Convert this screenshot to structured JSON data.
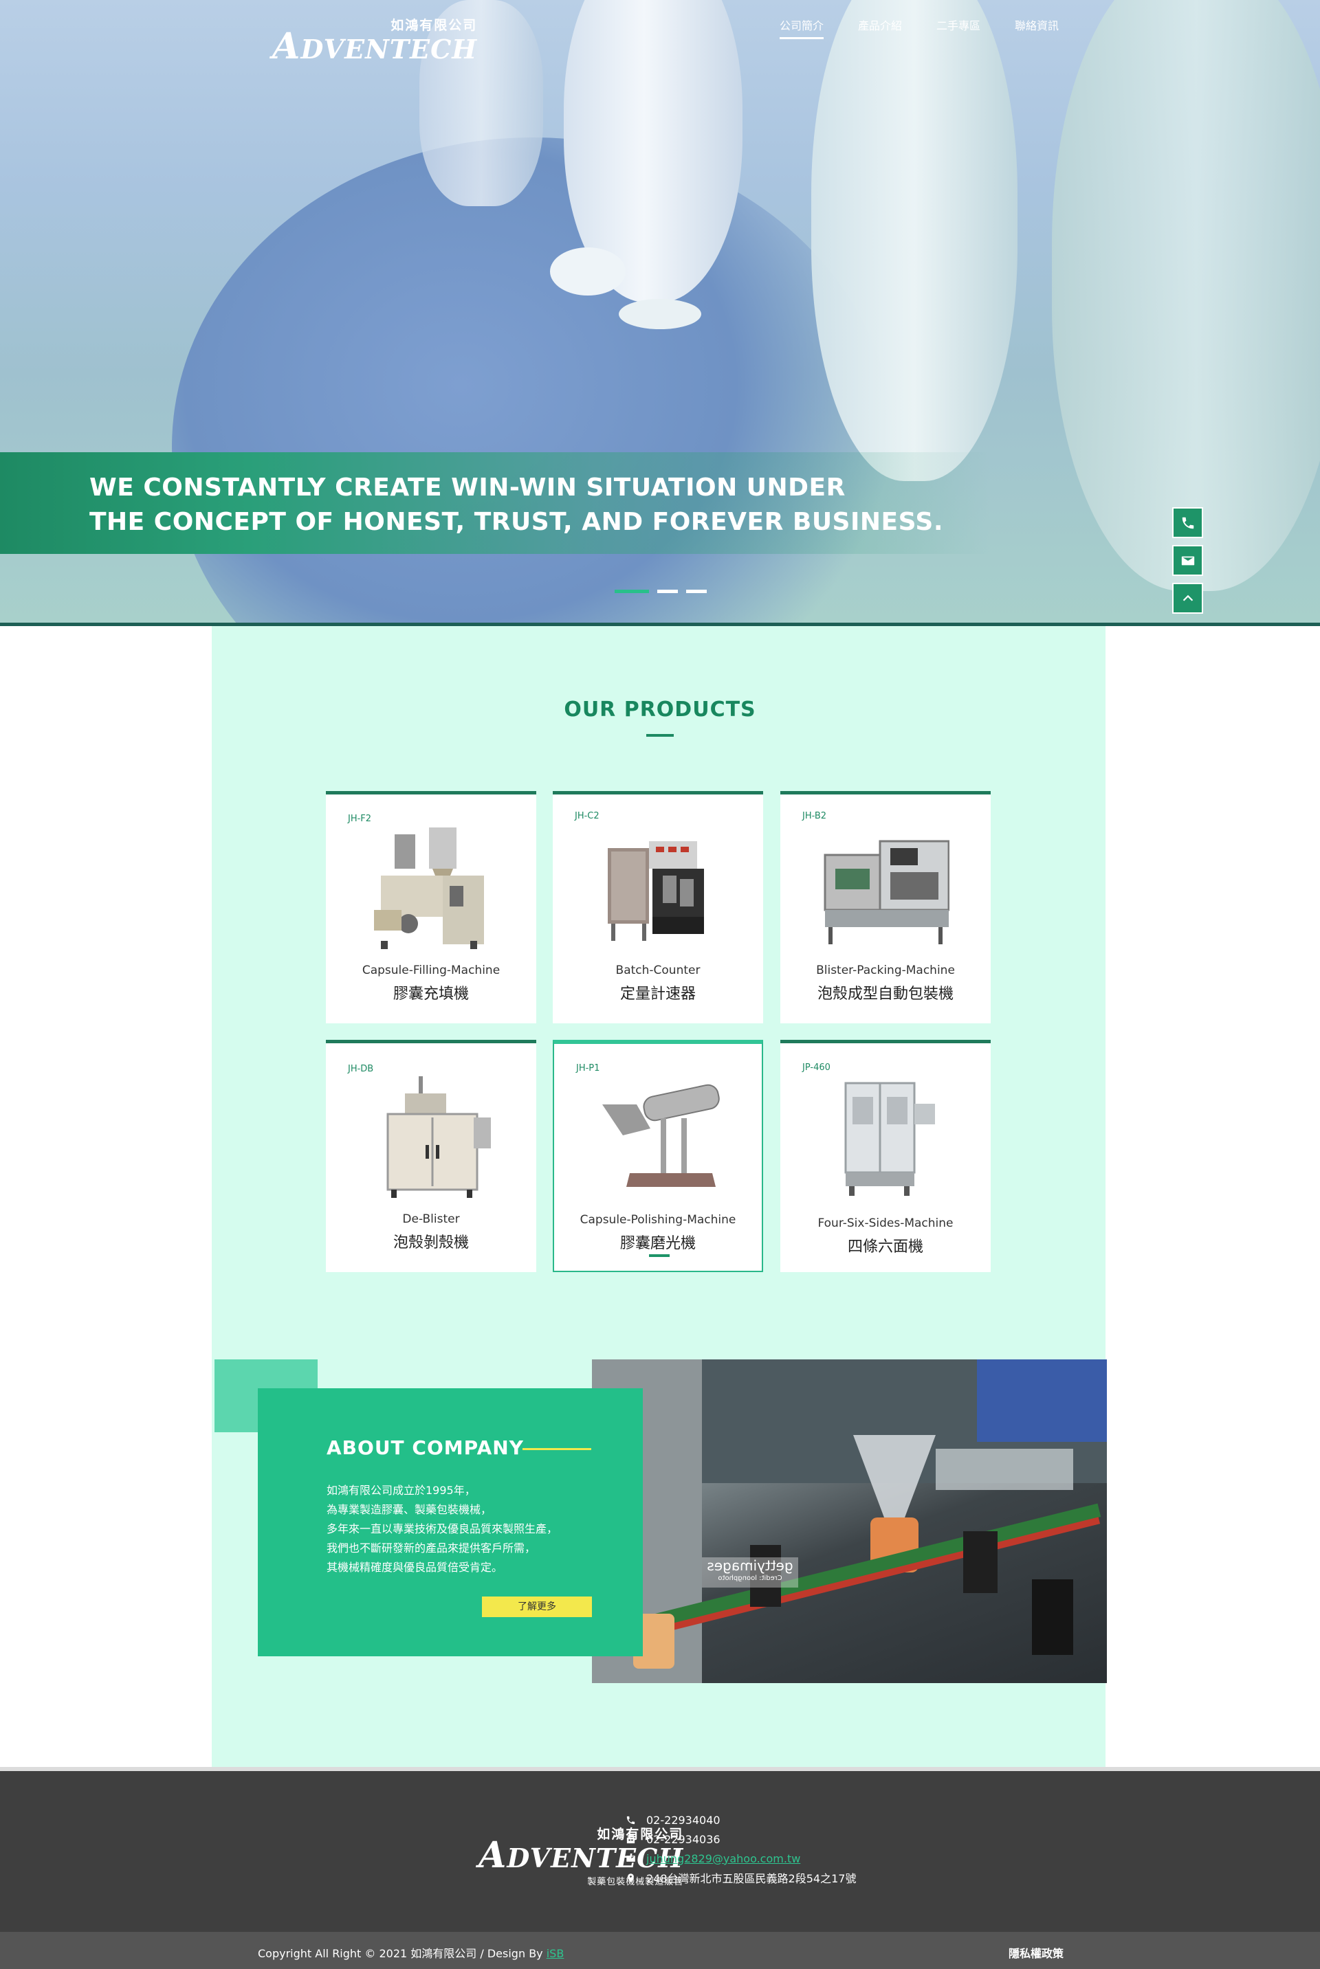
{
  "header": {
    "logo_zh": "如鴻有限公司",
    "logo_en_first": "A",
    "logo_en_rest": "DVENTECH",
    "nav": [
      {
        "label": "公司簡介",
        "active": true
      },
      {
        "label": "產品介紹"
      },
      {
        "label": "二手專區"
      },
      {
        "label": "聯絡資訊"
      }
    ]
  },
  "hero": {
    "line1": "WE CONSTANTLY CREATE WIN-WIN SITUATION UNDER",
    "line2": "THE CONCEPT OF HONEST, TRUST, AND FOREVER BUSINESS."
  },
  "side_buttons": [
    "phone-icon",
    "mail-icon",
    "chevron-up-icon"
  ],
  "products": {
    "title": "OUR PRODUCTS",
    "items": [
      {
        "code": "JH-F2",
        "en": "Capsule-Filling-Machine",
        "zh": "膠囊充填機"
      },
      {
        "code": "JH-C2",
        "en": "Batch-Counter",
        "zh": "定量計速器"
      },
      {
        "code": "JH-B2",
        "en": "Blister-Packing-Machine",
        "zh": "泡殼成型自動包裝機"
      },
      {
        "code": "JH-DB",
        "en": "De-Blister",
        "zh": "泡殼剝殼機"
      },
      {
        "code": "JH-P1",
        "en": "Capsule-Polishing-Machine",
        "zh": "膠囊磨光機"
      },
      {
        "code": "JP-460",
        "en": "Four-Six-Sides-Machine",
        "zh": "四條六面機"
      }
    ]
  },
  "about": {
    "title": "ABOUT COMPANY",
    "lines": [
      "如鴻有限公司成立於1995年，",
      "為專業製造膠囊、製藥包裝機械，",
      "多年來一直以專業技術及優良品質來製照生產，",
      "我們也不斷研發新的產品來提供客戶所需，",
      "其機械精確度與優良品質倍受肯定。"
    ],
    "button": "了解更多",
    "watermark1": "gettyimages",
    "watermark2": "Credit: loongphoto"
  },
  "footer": {
    "logo_sub": "製藥包裝機械製造販售",
    "phone": "02-22934040",
    "fax": "02-22934036",
    "email": "juhung2829@yahoo.com.tw",
    "address": "248台灣新北市五股區民義路2段54之17號",
    "copyright": "Copyright All Right © 2021 如鴻有限公司  /  Design By",
    "designer": "iSB",
    "privacy": "隱私權政策"
  },
  "colors": {
    "primary_green": "#23bf89",
    "dark_green": "#1e8a63",
    "mint_bg": "#d5fcee",
    "accent_yellow": "#f3e84c",
    "footer_bg": "#3f3f3f"
  }
}
